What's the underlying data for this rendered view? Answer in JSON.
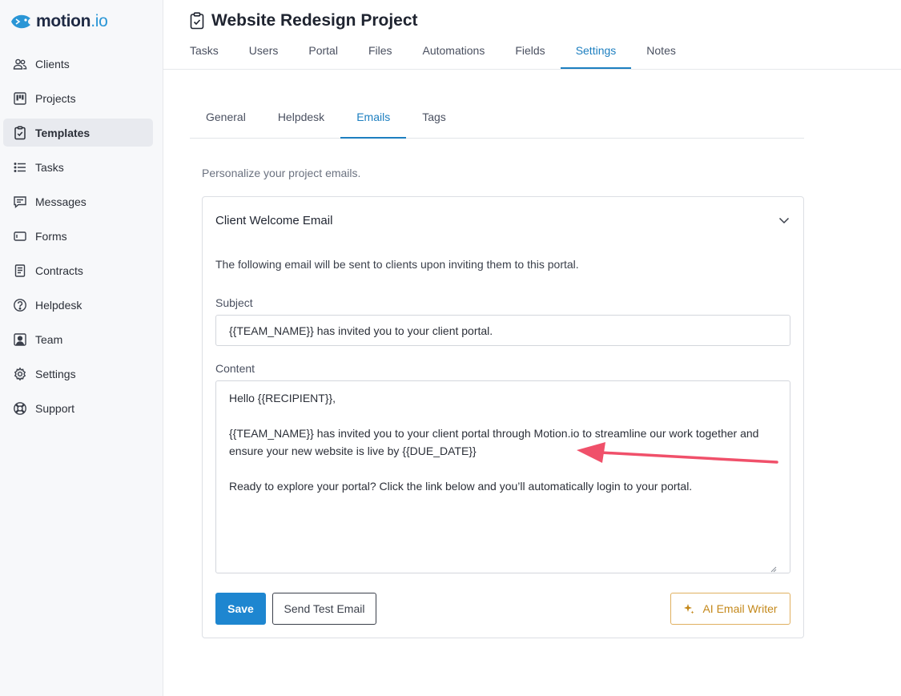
{
  "brand": {
    "name": "motion",
    "suffix": ".io",
    "accent": "#2a96d6"
  },
  "sidebar": {
    "items": [
      {
        "label": "Clients",
        "icon": "users-icon"
      },
      {
        "label": "Projects",
        "icon": "kanban-icon"
      },
      {
        "label": "Templates",
        "icon": "clipboard-check-icon",
        "active": true
      },
      {
        "label": "Tasks",
        "icon": "list-icon"
      },
      {
        "label": "Messages",
        "icon": "message-icon"
      },
      {
        "label": "Forms",
        "icon": "form-icon"
      },
      {
        "label": "Contracts",
        "icon": "document-icon"
      },
      {
        "label": "Helpdesk",
        "icon": "question-circle-icon"
      },
      {
        "label": "Team",
        "icon": "team-badge-icon"
      },
      {
        "label": "Settings",
        "icon": "gear-icon"
      },
      {
        "label": "Support",
        "icon": "lifebuoy-icon"
      }
    ]
  },
  "header": {
    "title": "Website Redesign Project",
    "tabs": [
      "Tasks",
      "Users",
      "Portal",
      "Files",
      "Automations",
      "Fields",
      "Settings",
      "Notes"
    ],
    "active_tab": "Settings"
  },
  "settings": {
    "tabs": [
      "General",
      "Helpdesk",
      "Emails",
      "Tags"
    ],
    "active_tab": "Emails",
    "intro": "Personalize your project emails."
  },
  "email": {
    "title": "Client Welcome Email",
    "description": "The following email will be sent to clients upon inviting them to this portal.",
    "subject_label": "Subject",
    "subject_value": "{{TEAM_NAME}} has invited you to your client portal.",
    "content_label": "Content",
    "content_value": "Hello {{RECIPIENT}},\n\n{{TEAM_NAME}} has invited you to your client portal through Motion.io to streamline our work together and ensure your new website is live by {{DUE_DATE}}\n\nReady to explore your portal? Click the link below and you’ll automatically login to your portal.",
    "save_label": "Save",
    "test_label": "Send Test Email",
    "ai_label": "AI Email Writer"
  },
  "colors": {
    "primary": "#1e86d0",
    "ai_accent": "#c4881a",
    "annotation_arrow": "#f0506a"
  }
}
